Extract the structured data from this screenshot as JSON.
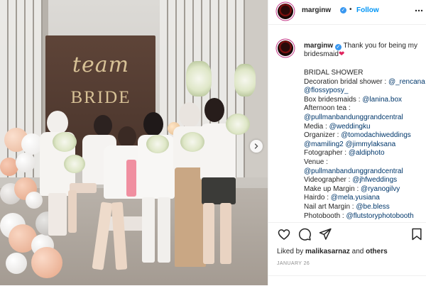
{
  "photo": {
    "backdrop_text_1": "team",
    "backdrop_text_2": "BRIDE"
  },
  "header": {
    "username": "marginw",
    "separator": "•",
    "follow_label": "Follow",
    "more_icon": "more-horizontal-icon",
    "verified_icon": "verified-badge-icon"
  },
  "caption": {
    "username": "marginw",
    "first_text": "Thank you for being my bridesmaid",
    "heart": "❤",
    "lines": [
      {
        "text": "BRIDAL SHOWER",
        "link": ""
      },
      {
        "text": "Decoration bridal shower : ",
        "link": "@_rencana"
      },
      {
        "text": "",
        "link": "@flossyposy_"
      },
      {
        "text": "Box bridesmaids : ",
        "link": "@lanina.box"
      },
      {
        "text": "Afternoon tea :",
        "link": ""
      },
      {
        "text": "",
        "link": "@pullmanbandunggrandcentral"
      },
      {
        "text": "Media : ",
        "link": "@weddingku"
      },
      {
        "text": "Organizer : ",
        "link": "@tomodachiweddings"
      },
      {
        "text": "",
        "link": "@mamiling2 @jimmylaksana"
      },
      {
        "text": "Fotographer : ",
        "link": "@aldiphoto"
      },
      {
        "text": "Venue :",
        "link": ""
      },
      {
        "text": "",
        "link": "@pullmanbandunggrandcentral"
      },
      {
        "text": "Videographer : ",
        "link": "@jhfweddings"
      },
      {
        "text": "Make up Margin : ",
        "link": "@ryanogilvy"
      },
      {
        "text": "Hairdo : ",
        "link": "@mela.yusiana"
      },
      {
        "text": "Nail art Margin : ",
        "link": "@be.bless"
      },
      {
        "text": "Photobooth : ",
        "link": "@flutstoryphotobooth"
      }
    ]
  },
  "actions": {
    "like_icon": "heart-icon",
    "comment_icon": "comment-icon",
    "share_icon": "share-icon",
    "save_icon": "bookmark-icon"
  },
  "likes": {
    "prefix": "Liked by ",
    "user": "malikasarnaz",
    "middle": " and ",
    "others": "others"
  },
  "date": "JANUARY 26",
  "colors": {
    "link": "#00376b",
    "follow": "#0095f6",
    "verified": "#3897f0",
    "heart": "#e0245e"
  }
}
